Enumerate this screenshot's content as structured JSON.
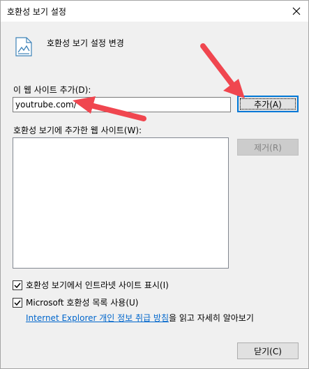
{
  "window": {
    "title": "호환성 보기 설정",
    "header": "호환성 보기 설정 변경"
  },
  "add_site": {
    "label": "이 웹 사이트 추가(D):",
    "value": "youtrube.com/",
    "button": "추가(A)"
  },
  "site_list": {
    "label": "호환성 보기에 추가한 웹 사이트(W):",
    "items": [],
    "remove_button": "제거(R)"
  },
  "options": {
    "intranet_label": "호환성 보기에서 인트라넷 사이트 표시(I)",
    "intranet_checked": true,
    "ms_list_label": "Microsoft 호환성 목록 사용(U)",
    "ms_list_checked": true
  },
  "privacy": {
    "link_text": "Internet Explorer 개인 정보 취급 방침",
    "suffix_text": "을 읽고 자세히 알아보기"
  },
  "footer": {
    "close_button": "닫기(C)"
  },
  "colors": {
    "annotation_arrow": "#f0464f",
    "link": "#0066cc",
    "focus_border": "#0078d7"
  }
}
